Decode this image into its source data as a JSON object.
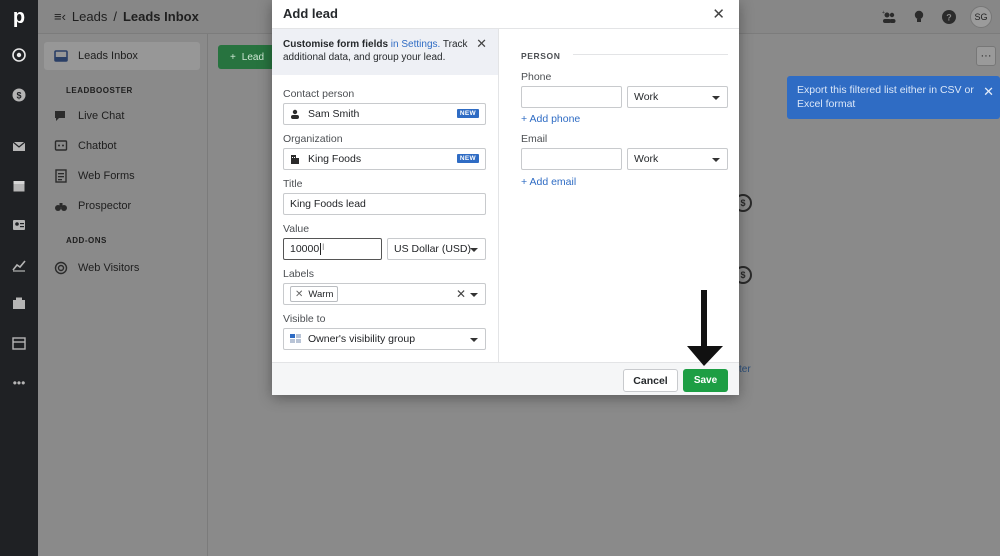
{
  "app": {
    "logo": "p",
    "breadcrumb": {
      "parent": "Leads",
      "separator": "/",
      "current": "Leads Inbox"
    },
    "avatar_initials": "SG",
    "sidebar": {
      "active_item": "Leads Inbox",
      "leadbooster_title": "LEADBOOSTER",
      "leadbooster_items": [
        "Live Chat",
        "Chatbot",
        "Web Forms",
        "Prospector"
      ],
      "addons_title": "ADD-ONS",
      "addons_items": [
        "Web Visitors"
      ]
    },
    "content": {
      "lead_button_label": "Lead",
      "more_button_label": "···",
      "tooltip_text": "Export this filtered list either in CSV or Excel format",
      "partial_link_text": "ster"
    }
  },
  "modal": {
    "title": "Add lead",
    "banner": {
      "bold": "Customise form fields",
      "link": " in Settings.",
      "rest": " Track additional data, and group your lead."
    },
    "fields": {
      "contact_person": {
        "label": "Contact person",
        "value": "Sam Smith",
        "badge": "NEW"
      },
      "organization": {
        "label": "Organization",
        "value": "King Foods",
        "badge": "NEW"
      },
      "title": {
        "label": "Title",
        "value": "King Foods lead"
      },
      "value": {
        "label": "Value",
        "amount": "10000",
        "currency": "US Dollar (USD)"
      },
      "labels": {
        "label": "Labels",
        "chip": "Warm"
      },
      "visible_to": {
        "label": "Visible to",
        "value": "Owner's visibility group"
      }
    },
    "person": {
      "section_title": "PERSON",
      "phone": {
        "label": "Phone",
        "value": "",
        "type": "Work",
        "add_link": "+ Add phone"
      },
      "email": {
        "label": "Email",
        "value": "",
        "type": "Work",
        "add_link": "+ Add email"
      }
    },
    "footer": {
      "cancel_label": "Cancel",
      "save_label": "Save"
    }
  },
  "colors": {
    "save": "#1d9e44",
    "link": "#2f6cc4",
    "tooltip": "#2f6cc4",
    "badge": "#2f6cc4"
  }
}
